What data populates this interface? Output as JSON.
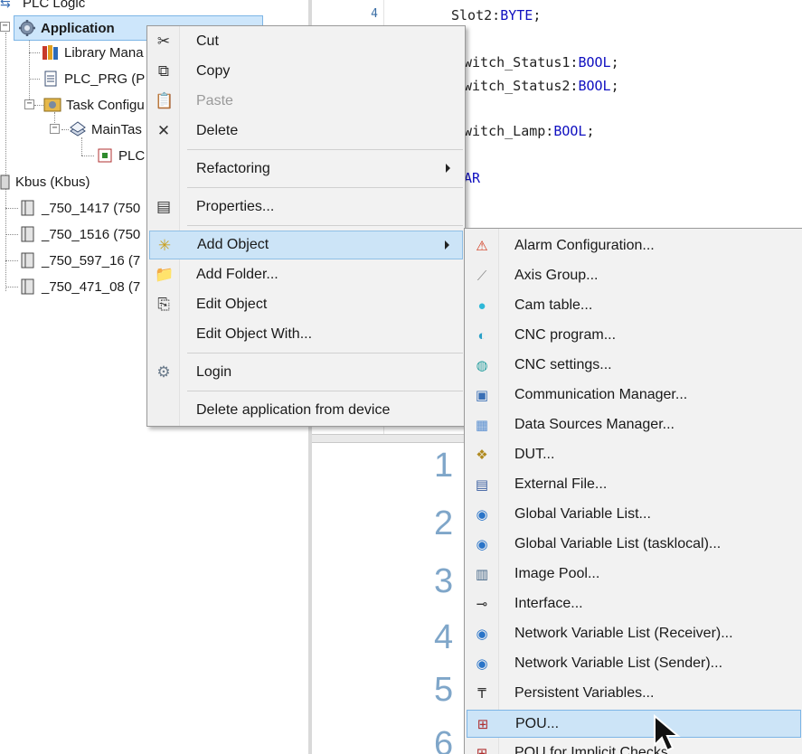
{
  "tree": {
    "root_label": "PLC Logic",
    "items": [
      {
        "label": "Application",
        "icon": "application-gear-icon"
      },
      {
        "label": "Library Mana",
        "icon": "library-books-icon"
      },
      {
        "label": "PLC_PRG (P",
        "icon": "pou-document-icon"
      },
      {
        "label": "Task Configu",
        "icon": "task-config-icon"
      },
      {
        "label": "MainTas",
        "icon": "task-icon"
      },
      {
        "label": "PLC",
        "icon": "pou-call-icon"
      },
      {
        "label": "Kbus (Kbus)",
        "icon": "bus-module-icon"
      },
      {
        "label": "_750_1417 (750",
        "icon": "io-module-icon"
      },
      {
        "label": "_750_1516 (750",
        "icon": "io-module-icon"
      },
      {
        "label": "_750_597_16 (7",
        "icon": "io-module-icon"
      },
      {
        "label": "_750_471_08 (7",
        "icon": "io-module-icon"
      }
    ]
  },
  "editor": {
    "line_number": "4",
    "lines": [
      {
        "prefix": "Slot2:",
        "type": "BYTE",
        "suffix": ";"
      },
      {
        "prefix": "witch_Status1:",
        "type": "BOOL",
        "suffix": ";"
      },
      {
        "prefix": "witch_Status2:",
        "type": "BOOL",
        "suffix": ";"
      },
      {
        "prefix": "witch_Lamp:",
        "type": "BOOL",
        "suffix": ";"
      },
      {
        "prefix": "",
        "type": "AR",
        "suffix": ""
      }
    ],
    "big_numbers": [
      "1",
      "2",
      "3",
      "4",
      "5",
      "6"
    ]
  },
  "context_menu": {
    "items": [
      {
        "label": "Cut",
        "icon": "scissors-icon",
        "glyph": "✂",
        "disabled": false
      },
      {
        "label": "Copy",
        "icon": "copy-icon",
        "glyph": "⧉",
        "disabled": false
      },
      {
        "label": "Paste",
        "icon": "paste-icon",
        "glyph": "📋",
        "disabled": true
      },
      {
        "label": "Delete",
        "icon": "delete-x-icon",
        "glyph": "✕",
        "disabled": false
      },
      {
        "label": "Refactoring",
        "icon": "",
        "glyph": "",
        "disabled": false,
        "submenu": true
      },
      {
        "label": "Properties...",
        "icon": "properties-icon",
        "glyph": "▤",
        "disabled": false
      },
      {
        "label": "Add Object",
        "icon": "add-object-icon",
        "glyph": "✳",
        "disabled": false,
        "submenu": true,
        "highlighted": true
      },
      {
        "label": "Add Folder...",
        "icon": "folder-icon",
        "glyph": "📁",
        "disabled": false
      },
      {
        "label": "Edit Object",
        "icon": "edit-object-icon",
        "glyph": "⎘",
        "disabled": false
      },
      {
        "label": "Edit Object With...",
        "icon": "",
        "glyph": "",
        "disabled": false
      },
      {
        "label": "Login",
        "icon": "login-gears-icon",
        "glyph": "⚙",
        "disabled": false
      },
      {
        "label": "Delete application from device",
        "icon": "",
        "glyph": "",
        "disabled": false
      }
    ]
  },
  "submenu": {
    "items": [
      {
        "label": "Alarm Configuration...",
        "icon": "alarm-icon",
        "glyph": "⚠",
        "color": "#d23a1e"
      },
      {
        "label": "Axis Group...",
        "icon": "axis-group-icon",
        "glyph": "⟋",
        "color": "#8a8a8a"
      },
      {
        "label": "Cam table...",
        "icon": "cam-table-icon",
        "glyph": "●",
        "color": "#2fb8d8"
      },
      {
        "label": "CNC program...",
        "icon": "cnc-program-icon",
        "glyph": "◐",
        "color": "#2aa0c8"
      },
      {
        "label": "CNC settings...",
        "icon": "cnc-settings-icon",
        "glyph": "◍",
        "color": "#2aa0a0"
      },
      {
        "label": "Communication Manager...",
        "icon": "communication-manager-icon",
        "glyph": "▣",
        "color": "#3a6fb5"
      },
      {
        "label": "Data Sources Manager...",
        "icon": "data-sources-icon",
        "glyph": "▦",
        "color": "#5a8fd0"
      },
      {
        "label": "DUT...",
        "icon": "dut-icon",
        "glyph": "❖",
        "color": "#b08a20"
      },
      {
        "label": "External File...",
        "icon": "external-file-icon",
        "glyph": "▤",
        "color": "#3a5ea0"
      },
      {
        "label": "Global Variable List...",
        "icon": "globe-icon",
        "glyph": "◉",
        "color": "#2a74c8"
      },
      {
        "label": "Global Variable List (tasklocal)...",
        "icon": "globe-task-icon",
        "glyph": "◉",
        "color": "#2a74c8"
      },
      {
        "label": "Image Pool...",
        "icon": "image-pool-icon",
        "glyph": "▥",
        "color": "#4a6a8a"
      },
      {
        "label": "Interface...",
        "icon": "interface-icon",
        "glyph": "⊸",
        "color": "#333333"
      },
      {
        "label": "Network Variable List (Receiver)...",
        "icon": "network-receiver-icon",
        "glyph": "◉",
        "color": "#2a74c8"
      },
      {
        "label": "Network Variable List (Sender)...",
        "icon": "network-sender-icon",
        "glyph": "◉",
        "color": "#2a74c8"
      },
      {
        "label": "Persistent Variables...",
        "icon": "persistent-pin-icon",
        "glyph": "₸",
        "color": "#333333"
      },
      {
        "label": "POU...",
        "icon": "pou-icon",
        "glyph": "⊞",
        "color": "#b03030",
        "highlighted": true
      },
      {
        "label": "POU for Implicit Checks",
        "icon": "pou-implicit-icon",
        "glyph": "⊞",
        "color": "#b03030"
      }
    ]
  },
  "colors": {
    "selection": "#cde6fb",
    "menu_bg": "#f2f2f2",
    "highlight": "#cce4f7",
    "keyword": "#1010c0",
    "big_number": "#7fa6c9"
  }
}
